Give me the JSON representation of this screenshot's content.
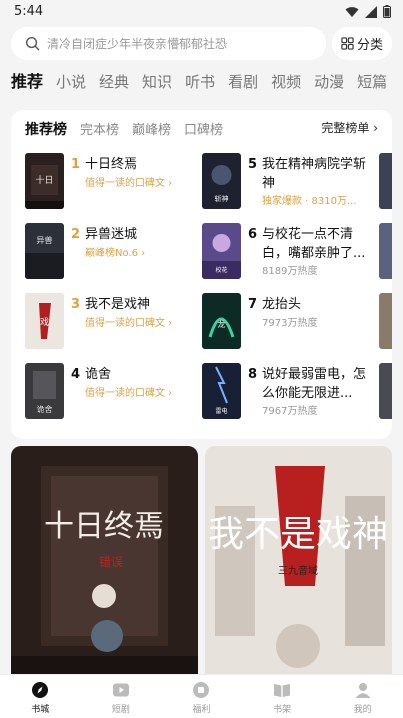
{
  "status_bar": {
    "time": "5:44",
    "icons": [
      "wifi-icon",
      "signal-icon",
      "battery-icon"
    ]
  },
  "search": {
    "placeholder": "清冷自闭症少年半夜亲懵郁郁社恐",
    "category_label": "分类"
  },
  "tabs": [
    "推荐",
    "小说",
    "经典",
    "知识",
    "听书",
    "看剧",
    "视频",
    "动漫",
    "短篇"
  ],
  "ranking": {
    "tabs": [
      "推荐榜",
      "完本榜",
      "巅峰榜",
      "口碑榜"
    ],
    "full_list_label": "完整榜单 ›",
    "books": [
      {
        "rank": "1",
        "title": "十日终焉",
        "subtitle": "值得一读的口碑文 ›"
      },
      {
        "rank": "2",
        "title": "异兽迷城",
        "subtitle": "巅峰榜No.6 ›"
      },
      {
        "rank": "3",
        "title": "我不是戏神",
        "subtitle": "值得一读的口碑文 ›"
      },
      {
        "rank": "4",
        "title": "诡舍",
        "subtitle": "值得一读的口碑文 ›"
      },
      {
        "rank": "5",
        "title": "我在精神病院学斩神",
        "subtitle": "独家爆款 · 8310万..."
      },
      {
        "rank": "6",
        "title": "与校花一点不清白，嘴都亲肿了...",
        "subtitle": "8189万热度"
      },
      {
        "rank": "7",
        "title": "龙抬头",
        "subtitle": "7973万热度"
      },
      {
        "rank": "8",
        "title": "说好最弱雷电，怎么你能无限进...",
        "subtitle": "7967万热度"
      }
    ]
  },
  "feed": [
    {
      "title": "十日终焉",
      "tag": "错误"
    },
    {
      "title": "我不是戏神",
      "author": "三九音域"
    }
  ],
  "bottom_nav": [
    {
      "label": "书城",
      "icon": "compass-icon",
      "active": true
    },
    {
      "label": "短剧",
      "icon": "play-icon",
      "active": false
    },
    {
      "label": "福利",
      "icon": "gift-icon",
      "active": false
    },
    {
      "label": "书架",
      "icon": "bookshelf-icon",
      "active": false
    },
    {
      "label": "我的",
      "icon": "profile-icon",
      "active": false
    }
  ],
  "colors": {
    "accent_orange": "#e0a040",
    "background": "#f4f4f4"
  }
}
